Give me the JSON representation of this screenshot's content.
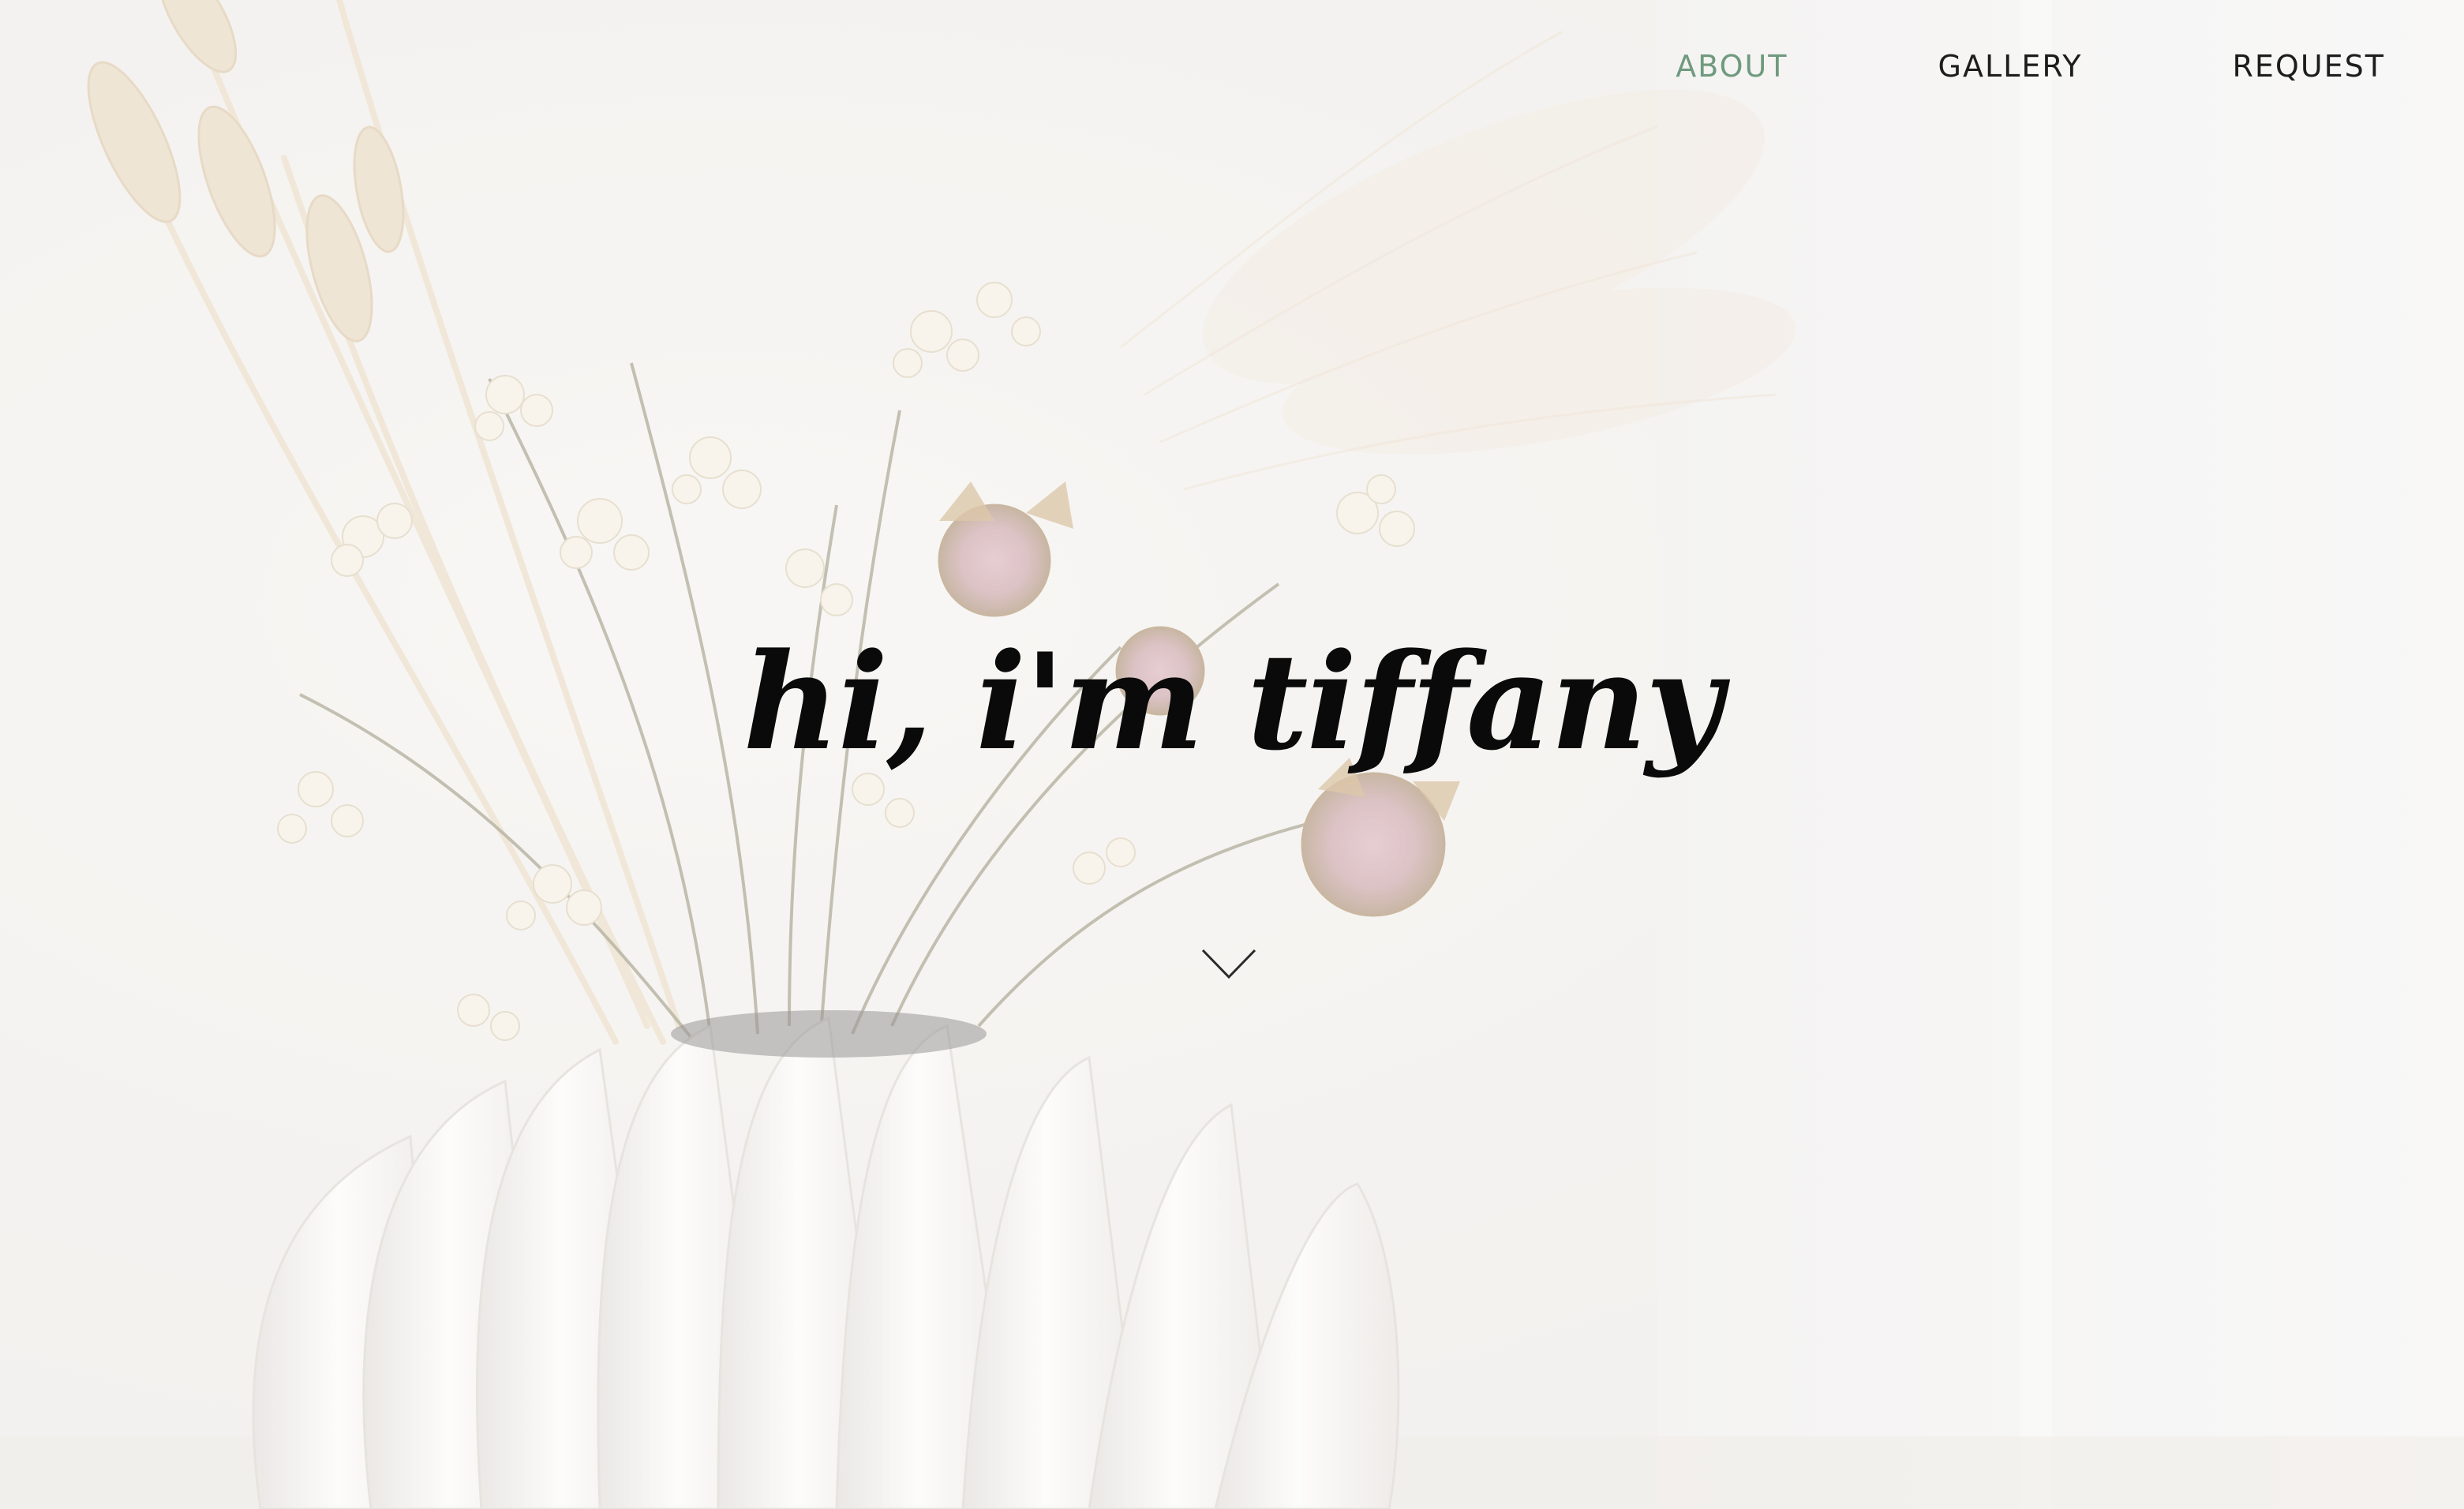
{
  "nav": {
    "items": [
      {
        "label": "ABOUT",
        "active": true
      },
      {
        "label": "GALLERY",
        "active": false
      },
      {
        "label": "REQUEST",
        "active": false
      }
    ]
  },
  "hero": {
    "headline": "hi, i'm tiffany",
    "scroll_icon": "chevron-down-icon",
    "background_image": "dried-flowers-in-white-fluted-vase"
  },
  "colors": {
    "accent": "#6f9a7f",
    "text": "#1d1d1d",
    "headline": "#0a0a0a",
    "background": "#efedea"
  }
}
